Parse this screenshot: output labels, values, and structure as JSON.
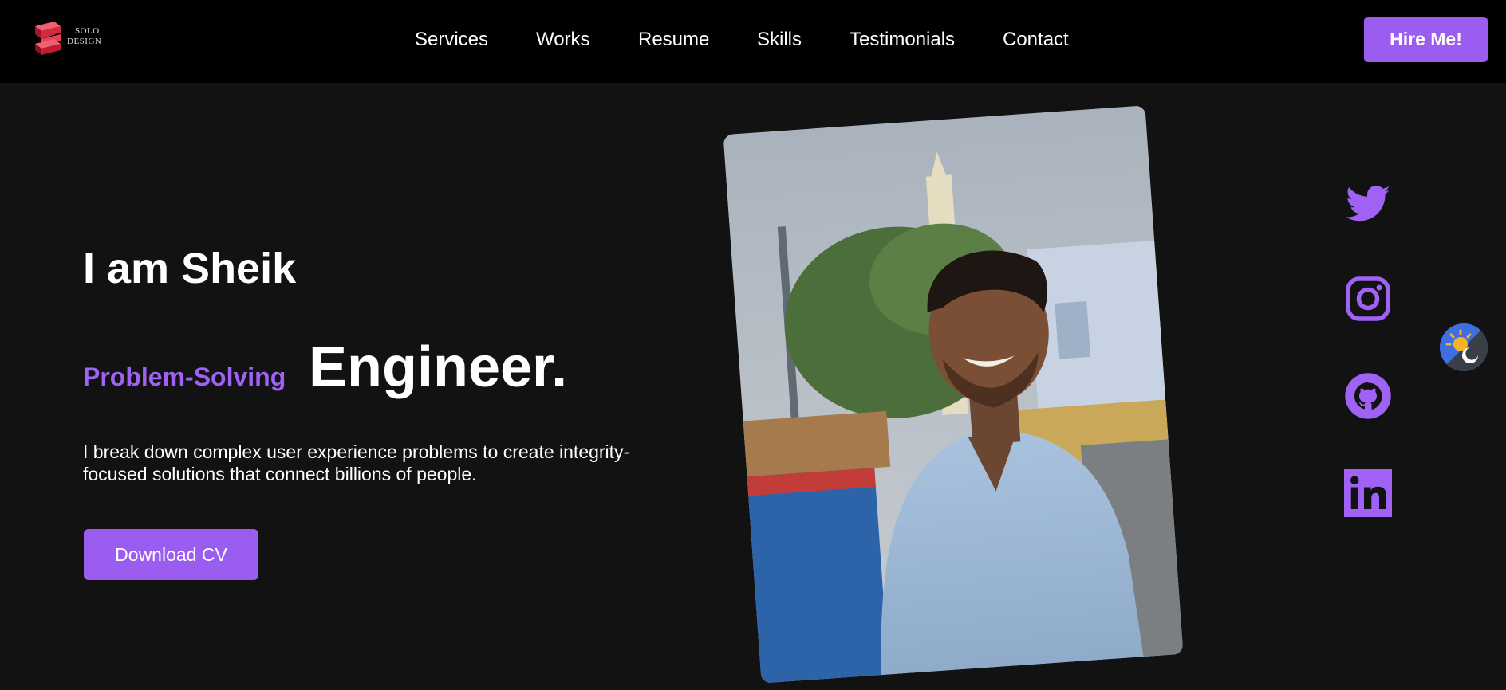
{
  "nav": {
    "logo_line1": "SOLO",
    "logo_line2": "DESIGN",
    "links": [
      "Services",
      "Works",
      "Resume",
      "Skills",
      "Testimonials",
      "Contact"
    ],
    "hire_label": "Hire Me!"
  },
  "hero": {
    "greeting": "I am Sheik",
    "role_accent": "Problem-Solving",
    "role_main": "Engineer.",
    "intro": "I break down complex user experience problems to create integrity-focused solutions that connect billions of people.",
    "cv_label": "Download CV"
  },
  "social": {
    "icons": [
      "twitter-icon",
      "instagram-icon",
      "github-icon",
      "linkedin-icon"
    ]
  },
  "colors": {
    "accent": "#9b5cf0",
    "nav_bg": "#000000",
    "page_bg": "#121212"
  }
}
